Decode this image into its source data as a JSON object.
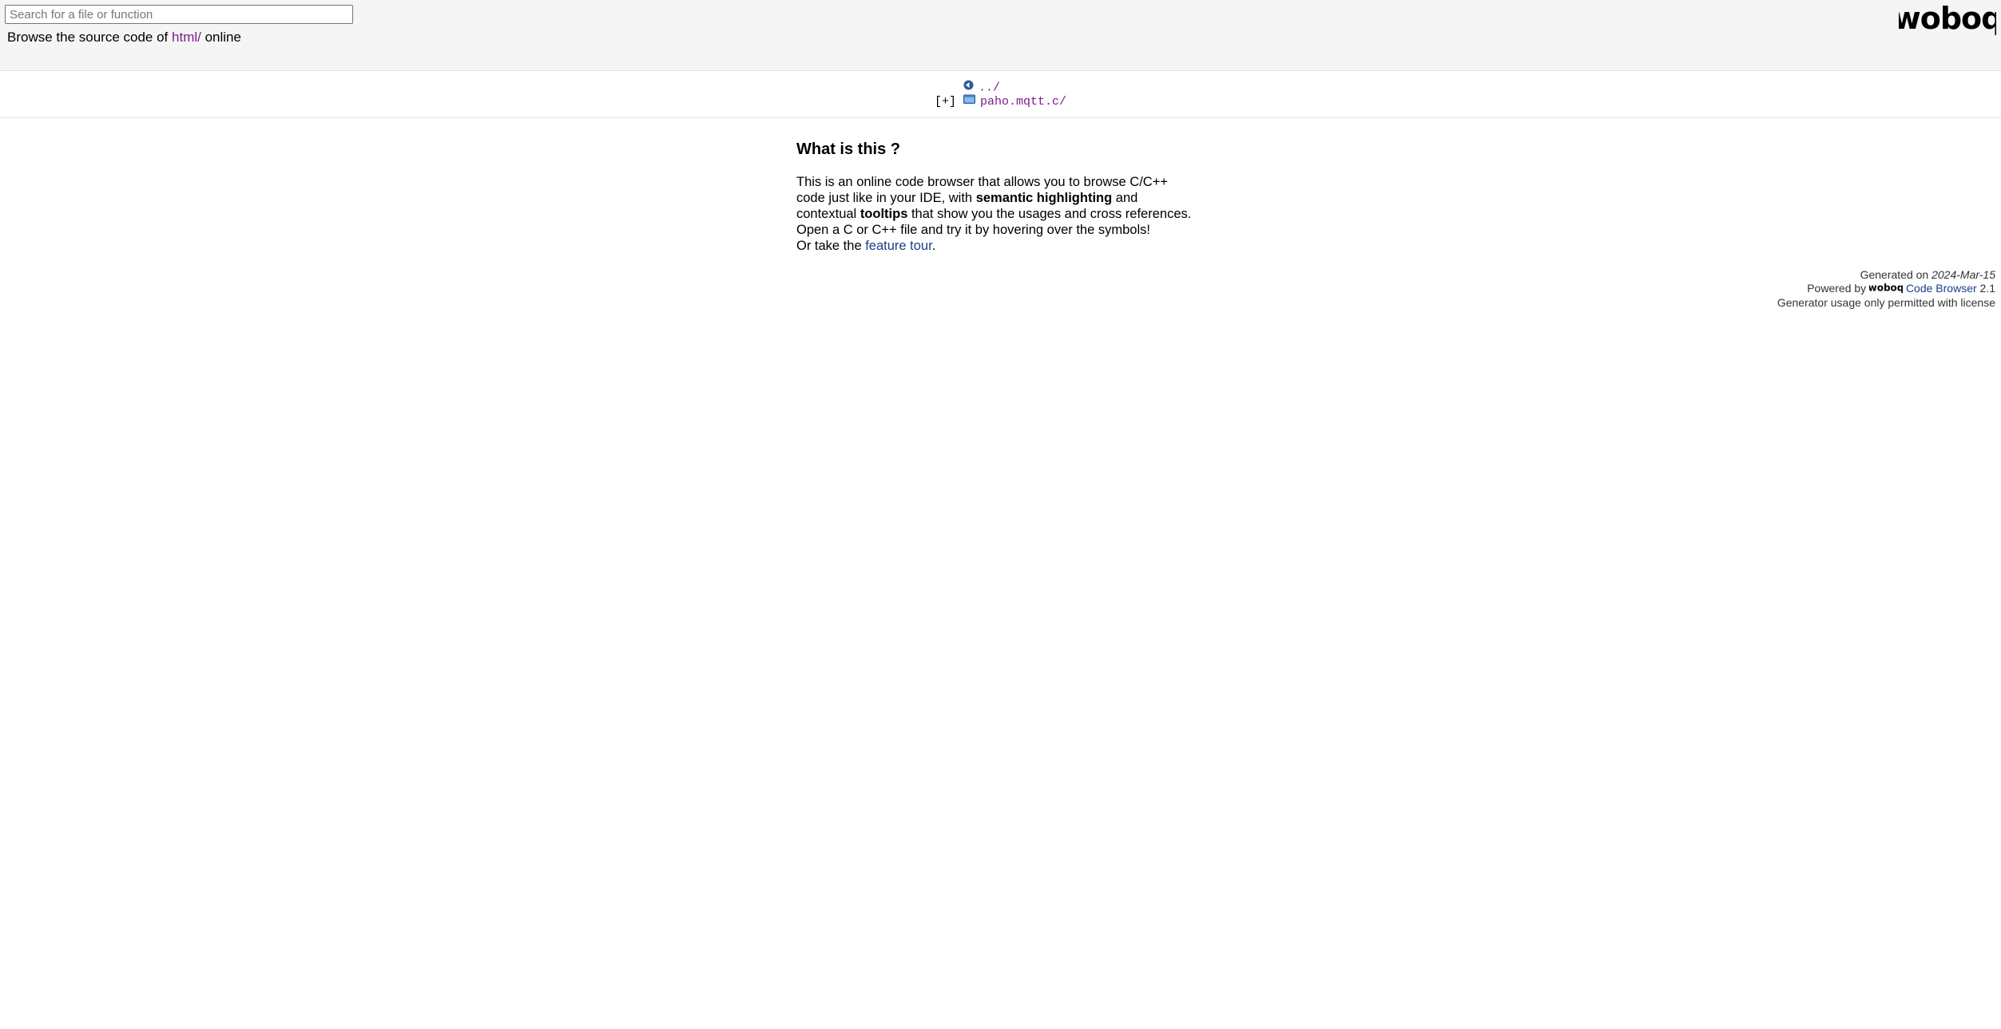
{
  "header": {
    "search_placeholder": "Search for a file or function",
    "browse_prefix": "Browse the source code of ",
    "browse_link": "html/",
    "browse_suffix": " online",
    "logo_text": "woboq"
  },
  "dirlist": {
    "parent_label": "../",
    "expand_toggle": "[+]",
    "folder_label": "paho.mqtt.c/",
    "parent_icon": "back-arrow-icon",
    "folder_icon": "folder-icon"
  },
  "info": {
    "heading": "What is this ?",
    "line1": "This is an online code browser that allows you to browse C/C++",
    "line2_a": "code just like in your IDE, with ",
    "line2_bold": "semantic highlighting",
    "line2_b": " and",
    "line3_a": "contextual ",
    "line3_bold": "tooltips",
    "line3_b": " that show you the usages and cross references.",
    "line4": "Open a C or C++ file and try it by hovering over the symbols!",
    "line5_a": "Or take the ",
    "line5_link": "feature tour",
    "line5_b": "."
  },
  "footer": {
    "generated_label": "Generated on ",
    "generated_date": "2024-Mar-15",
    "powered_label": "Powered by ",
    "powered_logo": "woboq",
    "powered_link": "Code Browser",
    "version": " 2.1",
    "license": "Generator usage only permitted with license"
  },
  "colors": {
    "header_bg": "#f5f5f5",
    "visited_link": "#7a1f8c",
    "link": "#1a3f8c"
  }
}
